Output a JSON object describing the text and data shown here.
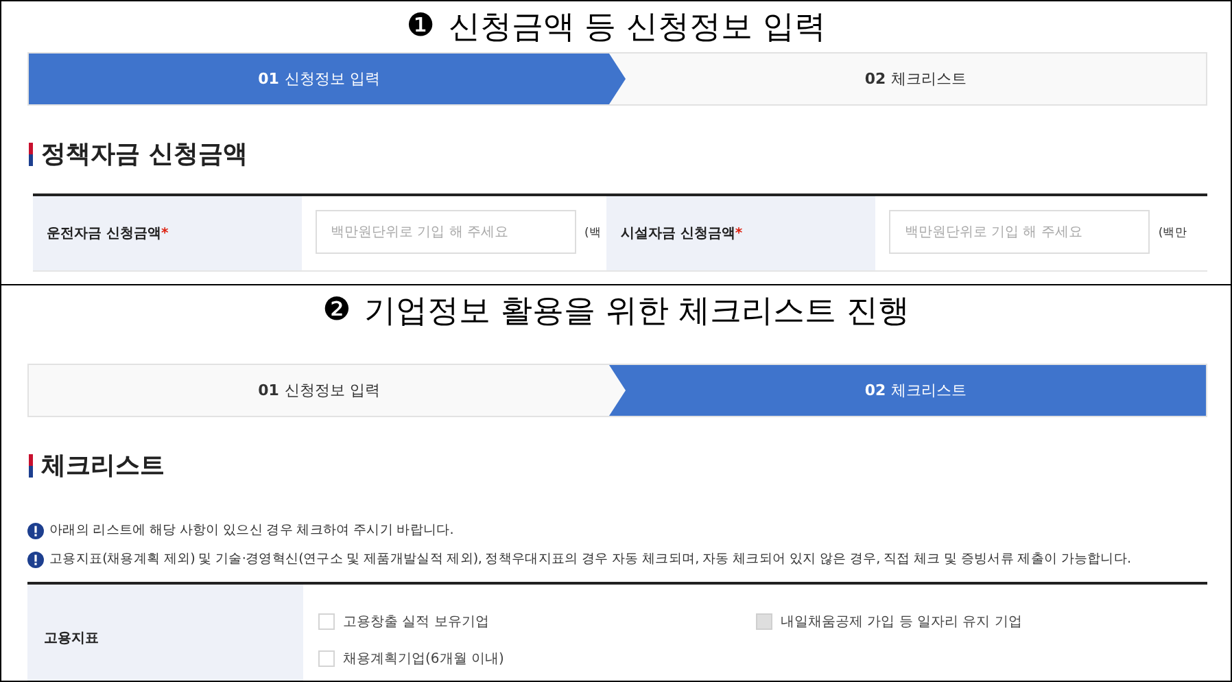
{
  "panels": [
    {
      "kind": "form",
      "caption_marker": "❶",
      "caption": "신청금액 등 신청정보 입력",
      "steps": [
        {
          "number": "01",
          "label": "신청정보 입력",
          "selected": true
        },
        {
          "number": "02",
          "label": "체크리스트",
          "selected": false
        }
      ],
      "section_title": "정책자금 신청금액",
      "fields": [
        {
          "label": "운전자금 신청금액",
          "required_mark": "*",
          "placeholder": "백만원단위로 기입 해 주세요",
          "unit": "(백"
        },
        {
          "label": "시설자금 신청금액",
          "required_mark": "*",
          "placeholder": "백만원단위로 기입 해 주세요",
          "unit": "(백만"
        }
      ]
    },
    {
      "kind": "checklist",
      "caption_marker": "❷",
      "caption": "기업정보 활용을 위한 체크리스트 진행",
      "steps": [
        {
          "number": "01",
          "label": "신청정보 입력",
          "selected": false
        },
        {
          "number": "02",
          "label": "체크리스트",
          "selected": true
        }
      ],
      "section_title": "체크리스트",
      "notices": [
        "아래의 리스트에 해당 사항이 있으신 경우 체크하여 주시기 바랍니다.",
        "고용지표(채용계획 제외) 및 기술·경영혁신(연구소 및 제품개발실적 제외), 정책우대지표의 경우 자동 체크되며, 자동 체크되어 있지 않은 경우, 직접 체크 및 증빙서류 제출이 가능합니다."
      ],
      "rows": [
        {
          "header": "고용지표",
          "items": [
            {
              "label": "고용창출 실적 보유기업",
              "checked": false,
              "disabled": false
            },
            {
              "label": "내일채움공제 가입 등 일자리 유지 기업",
              "checked": false,
              "disabled": true
            },
            {
              "label": "채용계획기업(6개월 이내)",
              "checked": false,
              "disabled": false
            }
          ]
        }
      ]
    }
  ]
}
